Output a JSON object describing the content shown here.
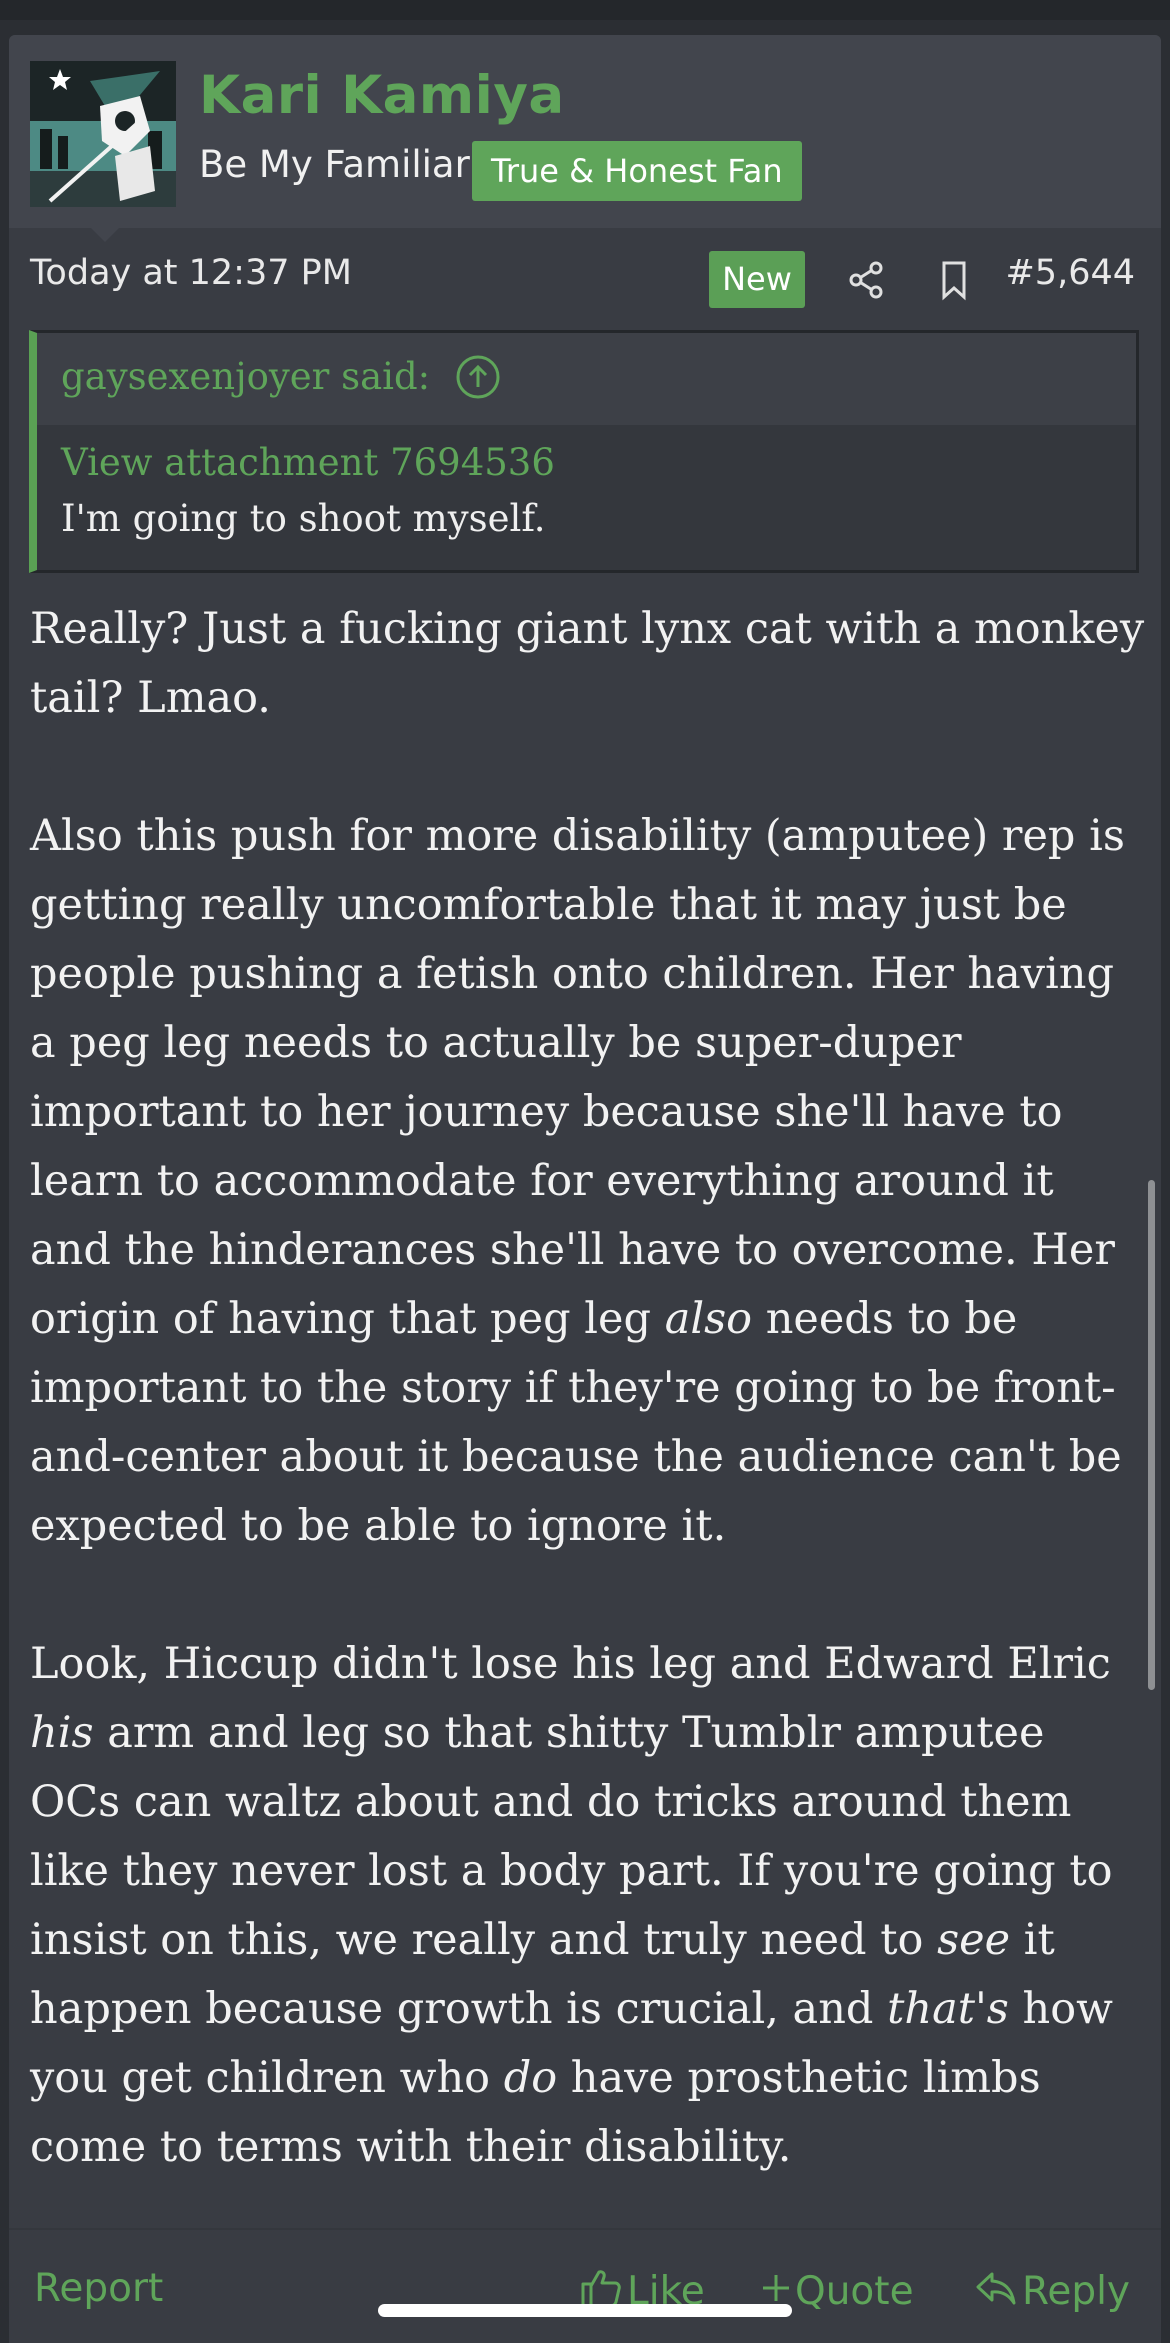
{
  "post": {
    "username": "Kari Kamiya",
    "user_title": "Be My Familiar",
    "user_banner": "True & Honest Fan",
    "date": "Today at 12:37 PM",
    "new_badge": "New",
    "post_number": "#5,644"
  },
  "quote": {
    "author": "gaysexenjoyer said:",
    "attachment": "View attachment 7694536",
    "text": "I'm going to shoot myself."
  },
  "body": {
    "lines": [
      "Really? Just a fucking giant lynx cat with a monkey",
      "tail? Lmao.",
      "",
      "Also this push for more disability (amputee) rep is",
      "getting really uncomfortable that it may just be",
      "people pushing a fetish onto children. Her having",
      "a peg leg needs to actually be super-duper",
      "important to her journey because she'll have to",
      "learn to accommodate for everything around it",
      "and the hinderances she'll have to overcome. Her",
      "origin of having that peg leg",
      "also",
      "needs to be",
      "important to the story if they're going to be front-",
      "and-center about it because the audience can't be",
      "expected to be able to ignore it.",
      "",
      "Look, Hiccup didn't lose his leg and Edward Elric",
      "his",
      "arm and leg so that shitty Tumblr amputee",
      "OCs can waltz about and do tricks around them",
      "like they never lost a body part. If you're going to",
      "insist on this, we really and truly need to",
      "see",
      "it",
      "happen because growth is crucial, and",
      "that's",
      "how",
      "you get children who",
      "do",
      "have prosthetic limbs",
      "come to terms with their disability."
    ]
  },
  "footer": {
    "report": "Report",
    "like": "Like",
    "quote": "Quote",
    "reply": "Reply"
  },
  "colors": {
    "accent_green": "#5fa55a",
    "post_bg": "#393c43",
    "header_bg": "#42454d",
    "page_bg": "#2b2e33"
  },
  "icons": {
    "share": "share-icon",
    "bookmark": "bookmark-icon",
    "quote_jump": "arrow-up-circle-icon",
    "like": "thumbs-up-icon",
    "quote": "plus-icon",
    "reply": "reply-icon"
  }
}
